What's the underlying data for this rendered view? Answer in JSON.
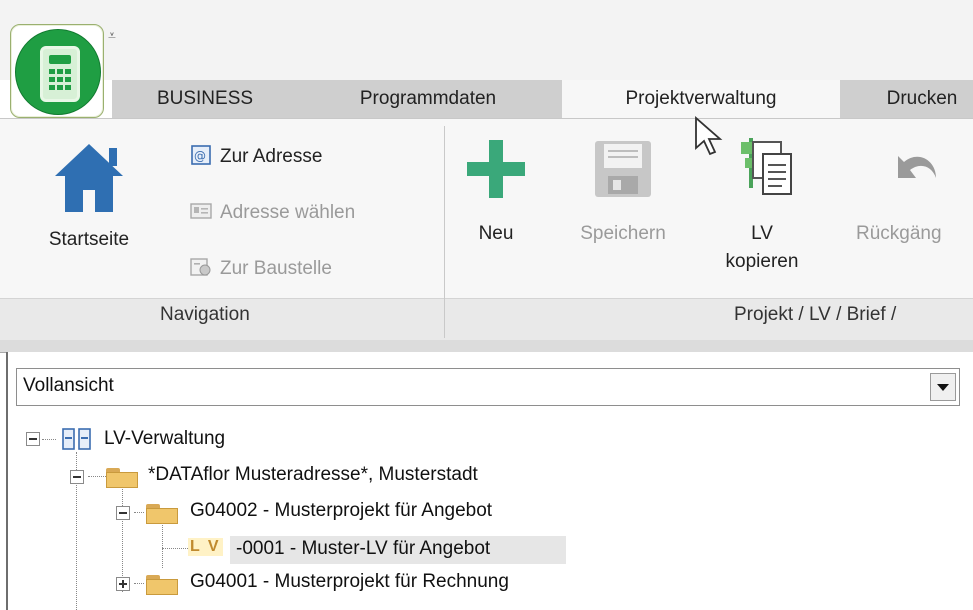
{
  "ribbon_tabs": [
    {
      "label": "BUSINESS",
      "active": false
    },
    {
      "label": "Programmdaten",
      "active": false
    },
    {
      "label": "Projektverwaltung",
      "active": true
    },
    {
      "label": "Drucken",
      "active": false
    }
  ],
  "qa_dropdown_glyph": "⩡",
  "groups": {
    "navigation": {
      "label": "Navigation",
      "startseite": "Startseite",
      "zur_adresse": "Zur Adresse",
      "adresse_waehlen": "Adresse wählen",
      "zur_baustelle": "Zur Baustelle"
    },
    "projekt": {
      "label": "Projekt / LV / Brief /",
      "neu": "Neu",
      "speichern": "Speichern",
      "lv_kopieren_line1": "LV",
      "lv_kopieren_line2": "kopieren",
      "rueckgaengig": "Rückgäng"
    }
  },
  "view_select": {
    "value": "Vollansicht"
  },
  "tree": {
    "root": "LV-Verwaltung",
    "address": "*DATAflor Musteradresse*, Musterstadt",
    "project1": "G04002 - Musterprojekt für Angebot",
    "lv_badge": "L V",
    "lv_item": "-0001 - Muster-LV für Angebot",
    "project2": "G04001 - Musterprojekt für Rechnung"
  },
  "colors": {
    "accent_green": "#1f9e43",
    "plus_green": "#3aa87a",
    "house_blue": "#2f6fb2",
    "folder": "#f0c66b"
  }
}
